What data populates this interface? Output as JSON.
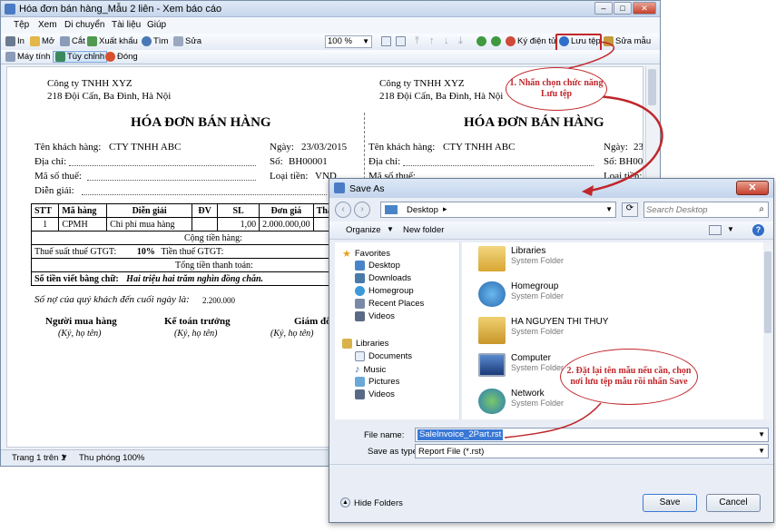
{
  "report_window": {
    "title": "Hóa đơn bán hàng_Mẫu 2 liên - Xem báo cáo",
    "menu": [
      "Tệp",
      "Xem",
      "Di chuyển",
      "Tài liệu",
      "Giúp"
    ],
    "toolbar": {
      "print": "In",
      "open": "Mở",
      "cut": "Cắt",
      "export": "Xuất khẩu",
      "find": "Tìm",
      "edit": "Sửa",
      "zoom": "100 %",
      "sign": "Ký điện tử",
      "save": "Lưu tệp",
      "edit_template": "Sửa mẫu"
    },
    "toolbar2": {
      "calculator": "Máy tính",
      "customize": "Tùy chỉnh",
      "close": "Đóng"
    },
    "status": {
      "page": "Trang 1 trên 1",
      "zoom": "Thu phóng 100%"
    }
  },
  "invoice": {
    "company": "Công ty TNHH XYZ",
    "address": "218 Đội Cấn, Ba Đình, Hà Nội",
    "title": "HÓA ĐƠN BÁN HÀNG",
    "customer_label": "Tên khách hàng:",
    "customer": "CTY TNHH ABC",
    "date_label": "Ngày:",
    "date": "23/03/2015",
    "date_short": "23/0",
    "address_label": "Địa chỉ:",
    "no_label": "Số:",
    "no": "BH00001",
    "no_short": "BH00",
    "tax_label": "Mã số thuế:",
    "currency_label": "Loại tiền:",
    "currency": "VND",
    "desc_label": "Diễn giải:",
    "table_header": [
      "STT",
      "Mã hàng",
      "Diễn giải",
      "ĐV",
      "SL",
      "Đơn giá",
      "Thà"
    ],
    "table_row": [
      "1",
      "CPMH",
      "Chi phí mua hàng",
      "",
      "1,00",
      "2.000.000,00",
      ""
    ],
    "subtotal_label": "Cộng tiền hàng:",
    "vat_rate_label": "Thuế suất thuế GTGT:",
    "vat_rate": "10%",
    "vat_amount_label": "Tiền thuế GTGT:",
    "total_label": "Tổng tiền thanh toán:",
    "words_label": "Số tiền viết bằng chữ:",
    "words": "Hai triệu hai trăm nghìn đồng chẵn.",
    "debt_label": "Số nợ của quý khách đến cuối ngày là:",
    "debt": "2.200.000",
    "buyer": "Người mua hàng",
    "accountant": "Kế toán trưởng",
    "director": "Giám đố",
    "sign_note": "(Ký, họ tên)"
  },
  "save_dialog": {
    "title": "Save As",
    "location": "Desktop",
    "search_placeholder": "Search Desktop",
    "organize": "Organize",
    "new_folder": "New folder",
    "nav": [
      "Favorites",
      "Desktop",
      "Downloads",
      "Homegroup",
      "Recent Places",
      "Videos",
      "Libraries",
      "Documents",
      "Music",
      "Pictures",
      "Videos"
    ],
    "items": [
      {
        "name": "Libraries",
        "type": "System Folder"
      },
      {
        "name": "Homegroup",
        "type": "System Folder"
      },
      {
        "name": "HA NGUYEN THI THUY",
        "type": "System Folder"
      },
      {
        "name": "Computer",
        "type": "System Folder"
      },
      {
        "name": "Network",
        "type": "System Folder"
      }
    ],
    "file_name_label": "File name:",
    "file_name": "SaleInvoice_2Part.rst",
    "save_type_label": "Save as type:",
    "save_type": "Report File (*.rst)",
    "hide_folders": "Hide Folders",
    "save": "Save",
    "cancel": "Cancel"
  },
  "callouts": {
    "step1": "1. Nhấn chọn chức năng Lưu tệp",
    "step2": "2. Đặt lại tên mẫu nếu cần, chọn nơi lưu tệp mẫu rồi nhấn Save"
  },
  "colors": {
    "callout": "#c0262a",
    "title_bar": "#c6d6ec",
    "selection": "#3a78d6"
  }
}
